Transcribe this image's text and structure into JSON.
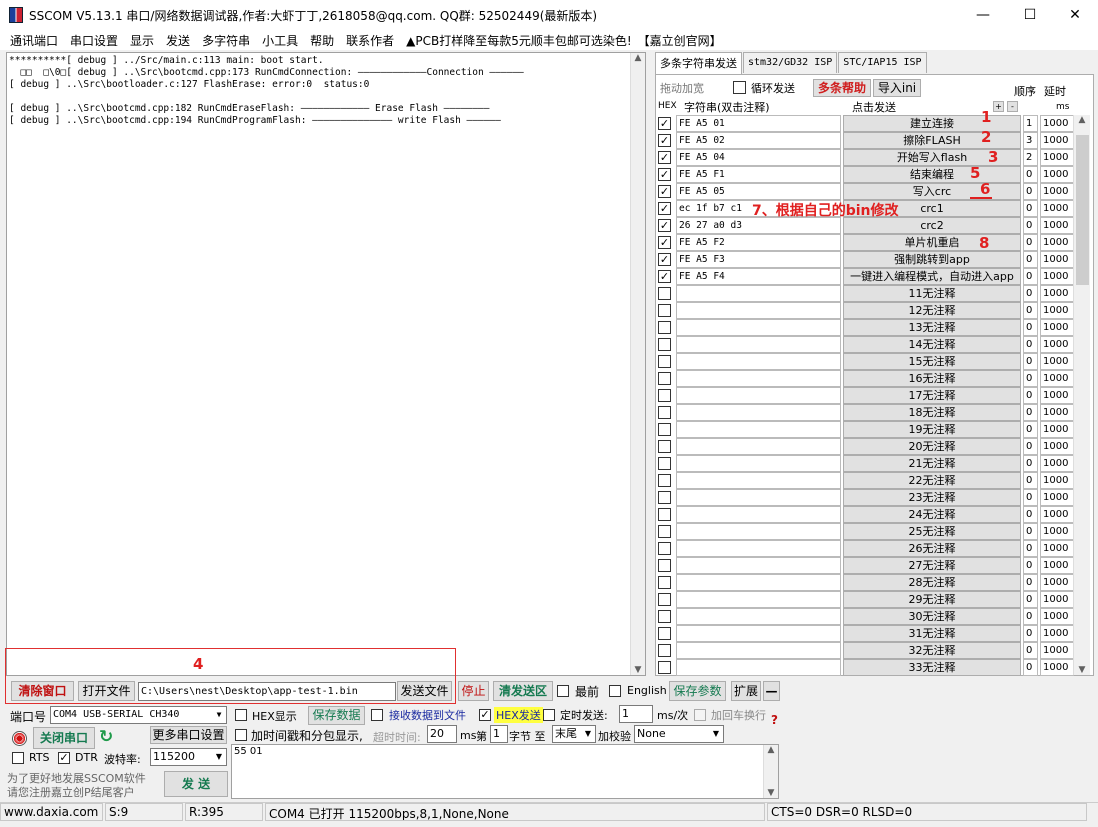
{
  "window": {
    "title": "SSCOM V5.13.1 串口/网络数据调试器,作者:大虾丁丁,2618058@qq.com. QQ群:  52502449(最新版本)",
    "min": "—",
    "max": "☐",
    "close": "✕"
  },
  "menu": [
    "通讯端口",
    "串口设置",
    "显示",
    "发送",
    "多字符串",
    "小工具",
    "帮助",
    "联系作者",
    "▲PCB打样降至每款5元顺丰包邮可选染色!",
    "【嘉立创官网】"
  ],
  "log": {
    "lines": [
      "**********[ debug ] ../Src/main.c:113 main: boot start.",
      "  □□  □\\0□[ debug ] ..\\Src\\bootcmd.cpp:173 RunCmdConnection: ————————————Connection ——————",
      "[ debug ] ..\\Src\\bootloader.c:127 FlashErase: error:0  status:0",
      "",
      "[ debug ] ..\\Src\\bootcmd.cpp:182 RunCmdEraseFlash: ———————————— Erase Flash ————————",
      "[ debug ] ..\\Src\\bootcmd.cpp:194 RunCmdProgramFlash: —————————————— write Flash ——————"
    ]
  },
  "multi": {
    "tabs": [
      "多条字符串发送",
      "stm32/GD32 ISP",
      "STC/IAP15 ISP"
    ],
    "drag_label": "拖动加宽",
    "loop_label": "循环发送",
    "help_btn": "多条帮助",
    "import_btn": "导入ini",
    "seq_label": "顺序",
    "delay_label": "延时",
    "hex_hdr": "HEX",
    "str_hdr": "字符串(双击注释)",
    "click_hdr": "点击发送",
    "ms_hdr": "ms",
    "plus": "+",
    "minus": "-",
    "rows": [
      {
        "checked": true,
        "hex": "FE A5 01",
        "label": "建立连接",
        "seq": "1",
        "delay": "1000"
      },
      {
        "checked": true,
        "hex": "FE A5 02",
        "label": "擦除FLASH",
        "seq": "3",
        "delay": "1000"
      },
      {
        "checked": true,
        "hex": "FE A5 04",
        "label": "开始写入flash",
        "seq": "2",
        "delay": "1000"
      },
      {
        "checked": true,
        "hex": "FE A5 F1",
        "label": "结束编程",
        "seq": "0",
        "delay": "1000"
      },
      {
        "checked": true,
        "hex": "FE A5 05",
        "label": "写入crc",
        "seq": "0",
        "delay": "1000"
      },
      {
        "checked": true,
        "hex": "ec 1f b7 c1",
        "label": "crc1",
        "seq": "0",
        "delay": "1000"
      },
      {
        "checked": true,
        "hex": "26 27 a0 d3",
        "label": "crc2",
        "seq": "0",
        "delay": "1000"
      },
      {
        "checked": true,
        "hex": "FE A5 F2",
        "label": "单片机重启",
        "seq": "0",
        "delay": "1000"
      },
      {
        "checked": true,
        "hex": "FE A5 F3",
        "label": "强制跳转到app",
        "seq": "0",
        "delay": "1000"
      },
      {
        "checked": true,
        "hex": "FE A5 F4",
        "label": "一键进入编程模式，自动进入app",
        "seq": "0",
        "delay": "1000"
      },
      {
        "checked": false,
        "hex": "",
        "label": "11无注释",
        "seq": "0",
        "delay": "1000"
      },
      {
        "checked": false,
        "hex": "",
        "label": "12无注释",
        "seq": "0",
        "delay": "1000"
      },
      {
        "checked": false,
        "hex": "",
        "label": "13无注释",
        "seq": "0",
        "delay": "1000"
      },
      {
        "checked": false,
        "hex": "",
        "label": "14无注释",
        "seq": "0",
        "delay": "1000"
      },
      {
        "checked": false,
        "hex": "",
        "label": "15无注释",
        "seq": "0",
        "delay": "1000"
      },
      {
        "checked": false,
        "hex": "",
        "label": "16无注释",
        "seq": "0",
        "delay": "1000"
      },
      {
        "checked": false,
        "hex": "",
        "label": "17无注释",
        "seq": "0",
        "delay": "1000"
      },
      {
        "checked": false,
        "hex": "",
        "label": "18无注释",
        "seq": "0",
        "delay": "1000"
      },
      {
        "checked": false,
        "hex": "",
        "label": "19无注释",
        "seq": "0",
        "delay": "1000"
      },
      {
        "checked": false,
        "hex": "",
        "label": "20无注释",
        "seq": "0",
        "delay": "1000"
      },
      {
        "checked": false,
        "hex": "",
        "label": "21无注释",
        "seq": "0",
        "delay": "1000"
      },
      {
        "checked": false,
        "hex": "",
        "label": "22无注释",
        "seq": "0",
        "delay": "1000"
      },
      {
        "checked": false,
        "hex": "",
        "label": "23无注释",
        "seq": "0",
        "delay": "1000"
      },
      {
        "checked": false,
        "hex": "",
        "label": "24无注释",
        "seq": "0",
        "delay": "1000"
      },
      {
        "checked": false,
        "hex": "",
        "label": "25无注释",
        "seq": "0",
        "delay": "1000"
      },
      {
        "checked": false,
        "hex": "",
        "label": "26无注释",
        "seq": "0",
        "delay": "1000"
      },
      {
        "checked": false,
        "hex": "",
        "label": "27无注释",
        "seq": "0",
        "delay": "1000"
      },
      {
        "checked": false,
        "hex": "",
        "label": "28无注释",
        "seq": "0",
        "delay": "1000"
      },
      {
        "checked": false,
        "hex": "",
        "label": "29无注释",
        "seq": "0",
        "delay": "1000"
      },
      {
        "checked": false,
        "hex": "",
        "label": "30无注释",
        "seq": "0",
        "delay": "1000"
      },
      {
        "checked": false,
        "hex": "",
        "label": "31无注释",
        "seq": "0",
        "delay": "1000"
      },
      {
        "checked": false,
        "hex": "",
        "label": "32无注释",
        "seq": "0",
        "delay": "1000"
      },
      {
        "checked": false,
        "hex": "",
        "label": "33无注释",
        "seq": "0",
        "delay": "1000"
      }
    ]
  },
  "annotations": {
    "n1": "1",
    "n2": "2",
    "n3": "3",
    "n4": "4",
    "n5": "5",
    "n6": "6",
    "n7": "7、根据自己的bin修改",
    "n8": "8"
  },
  "bar1": {
    "clear": "清除窗口",
    "open": "打开文件",
    "path": "C:\\Users\\nest\\Desktop\\app-test-1.bin",
    "sendfile": "发送文件",
    "stop": "停止",
    "clearsend": "清发送区",
    "top_label": "最前",
    "english_label": "English",
    "save_params": "保存参数",
    "expand": "扩展",
    "collapse": "—"
  },
  "ctrl": {
    "port_label": "端口号",
    "port_value": "COM4 USB-SERIAL CH340",
    "hexshow": "HEX显示",
    "savedata": "保存数据",
    "recvfile": "接收数据到文件",
    "hexsend": "HEX发送",
    "timed": "定时发送:",
    "timed_val": "1",
    "timed_unit": "ms/次",
    "crlf": "加回车换行",
    "q": "?",
    "close_port": "关闭串口",
    "more_port": "更多串口设置",
    "timestamp": "加时间戳和分包显示,",
    "timeout_label": "超时时间:",
    "timeout_val": "20",
    "ms": "ms",
    "nth": "第",
    "byte_val": "1",
    "byte_label": "字节 至",
    "end_val": "末尾",
    "check_label": "加校验",
    "check_val": "None",
    "rts": "RTS",
    "dtr": "DTR",
    "baud_label": "波特率:",
    "baud_val": "115200",
    "send_text": "55 01",
    "promo1": "为了更好地发展SSCOM软件",
    "promo2": "请您注册嘉立创P结尾客户",
    "send_btn": "发 送"
  },
  "status": {
    "site": "www.daxia.com",
    "s": "S:9",
    "r": "R:395",
    "port_info": "COM4 已打开  115200bps,8,1,None,None",
    "lines": "CTS=0 DSR=0 RLSD=0"
  }
}
